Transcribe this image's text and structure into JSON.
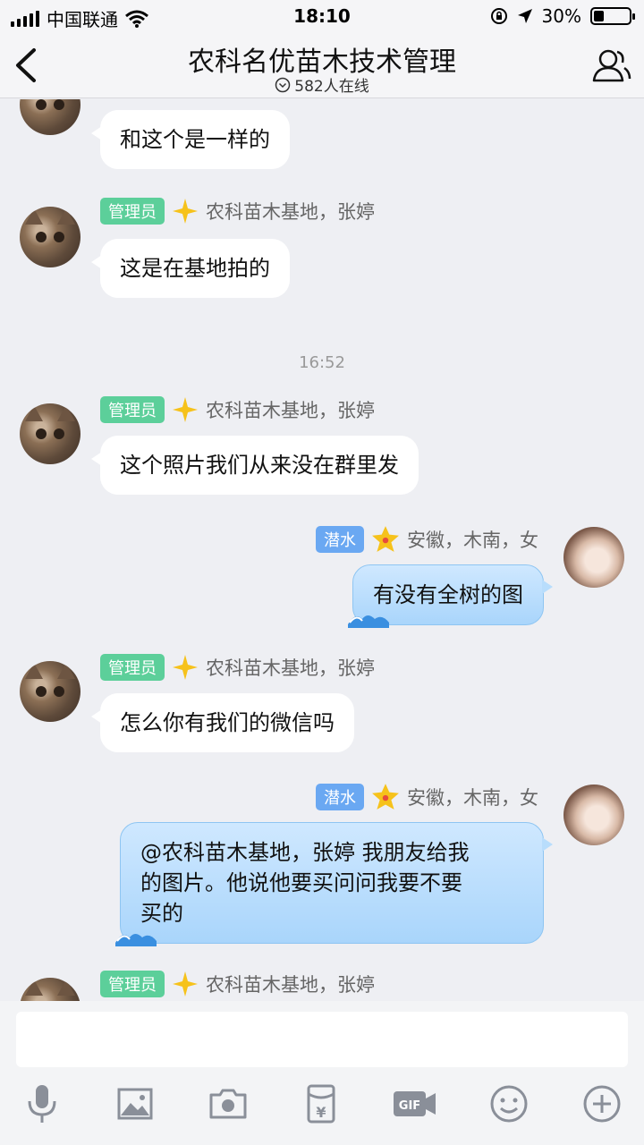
{
  "status_bar": {
    "carrier": "中国联通",
    "time": "18:10",
    "battery": "30%",
    "battery_level": 0.3
  },
  "header": {
    "title": "农科名优苗木技术管理",
    "online_count": "582人在线"
  },
  "messages": [
    {
      "side": "left",
      "badge": "",
      "name": "",
      "text": "和这个是一样的"
    },
    {
      "side": "left",
      "badge": "管理员",
      "name": "农科苗木基地，张婷",
      "text": "这是在基地拍的"
    },
    {
      "timestamp": "16:52"
    },
    {
      "side": "left",
      "badge": "管理员",
      "name": "农科苗木基地，张婷",
      "text": "这个照片我们从来没在群里发"
    },
    {
      "side": "right",
      "badge": "潜水",
      "name": "安徽，木南，女",
      "text": "有没有全树的图"
    },
    {
      "side": "left",
      "badge": "管理员",
      "name": "农科苗木基地，张婷",
      "text": "怎么你有我们的微信吗"
    },
    {
      "side": "right",
      "badge": "潜水",
      "name": "安徽，木南，女",
      "text_lines": [
        "@农科苗木基地，张婷 我朋友给我",
        "的图片。他说他要买问问我要不要",
        "买的"
      ]
    },
    {
      "side": "left",
      "badge": "管理员",
      "name": "农科苗木基地，张婷",
      "text": ""
    }
  ],
  "toolbar": {
    "icons": [
      "microphone-icon",
      "image-icon",
      "camera-icon",
      "red-packet-icon",
      "gif-icon",
      "emoji-icon",
      "plus-icon"
    ],
    "gif_label": "GIF",
    "yen_label": "¥"
  },
  "colors": {
    "admin_badge": "#5ccf9a",
    "dive_badge": "#6aa8f2",
    "bubble_right": "#a9d5fb",
    "background": "#eeeff3"
  }
}
